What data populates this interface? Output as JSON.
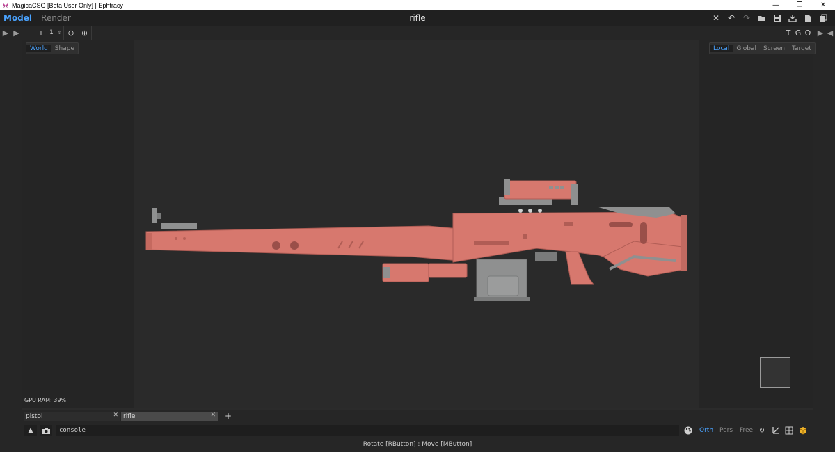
{
  "window": {
    "title": "MagicaCSG [Beta User Only] | Ephtracy"
  },
  "header": {
    "modes": [
      {
        "label": "Model",
        "active": true
      },
      {
        "label": "Render",
        "active": false
      }
    ],
    "document_title": "rifle"
  },
  "toolbar": {
    "count_value": "1",
    "tgo": [
      "T",
      "G",
      "O"
    ]
  },
  "viewport": {
    "left_modes": [
      {
        "label": "World",
        "active": true
      },
      {
        "label": "Shape",
        "active": false
      }
    ],
    "right_modes": [
      {
        "label": "Local",
        "active": true
      },
      {
        "label": "Global",
        "active": false
      },
      {
        "label": "Screen",
        "active": false
      },
      {
        "label": "Target",
        "active": false
      }
    ],
    "gpu_ram": "GPU RAM:  39%"
  },
  "tabs": [
    {
      "label": "pistol",
      "active": false
    },
    {
      "label": "rifle",
      "active": true
    }
  ],
  "console": {
    "value": "console"
  },
  "projection": [
    {
      "label": "Orth",
      "active": true
    },
    {
      "label": "Pers",
      "active": false
    },
    {
      "label": "Free",
      "active": false
    }
  ],
  "status": {
    "hint": "Rotate [RButton] : Move [MButton]"
  },
  "colors": {
    "accent": "#4aa3ff",
    "model": "#d7786e",
    "metal": "#8f9090"
  }
}
